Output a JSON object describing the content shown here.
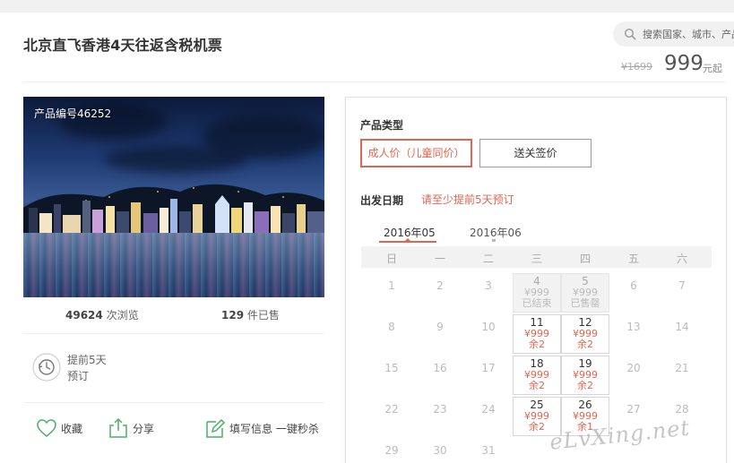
{
  "header": {
    "title": "北京直飞香港4天往返含税机票",
    "search_placeholder": "搜索国家、城市、产品",
    "old_price": "¥1699",
    "price": "999",
    "price_suffix": "元起"
  },
  "product": {
    "code_label": "产品编号46252",
    "views_count": "49624",
    "views_label": "次浏览",
    "sold_count": "129",
    "sold_label": "件已售",
    "advance_line1": "提前5天",
    "advance_line2": "预订"
  },
  "actions": {
    "favorite": "收藏",
    "share": "分享",
    "fill_info": "填写信息 一键秒杀"
  },
  "booking": {
    "type_label": "产品类型",
    "type_adult": "成人价（儿童同价）",
    "type_visa": "送关签价",
    "date_label": "出发日期",
    "date_hint": "请至少提前5天预订",
    "months": [
      "2016年05",
      "2016年06"
    ],
    "weekdays": [
      "日",
      "一",
      "二",
      "三",
      "四",
      "五",
      "六"
    ],
    "days": [
      {
        "n": "1",
        "p": "",
        "s": "",
        "state": "plain"
      },
      {
        "n": "2",
        "p": "",
        "s": "",
        "state": "plain"
      },
      {
        "n": "3",
        "p": "",
        "s": "",
        "state": "plain"
      },
      {
        "n": "4",
        "p": "¥999",
        "s": "已结束",
        "state": "closed"
      },
      {
        "n": "5",
        "p": "¥999",
        "s": "已售罄",
        "state": "closed"
      },
      {
        "n": "6",
        "p": "",
        "s": "",
        "state": "plain"
      },
      {
        "n": "7",
        "p": "",
        "s": "",
        "state": "plain"
      },
      {
        "n": "8",
        "p": "",
        "s": "",
        "state": "plain"
      },
      {
        "n": "9",
        "p": "",
        "s": "",
        "state": "plain"
      },
      {
        "n": "10",
        "p": "",
        "s": "",
        "state": "plain"
      },
      {
        "n": "11",
        "p": "¥999",
        "s": "余2",
        "state": "active"
      },
      {
        "n": "12",
        "p": "¥999",
        "s": "余2",
        "state": "active"
      },
      {
        "n": "13",
        "p": "",
        "s": "",
        "state": "plain"
      },
      {
        "n": "14",
        "p": "",
        "s": "",
        "state": "plain"
      },
      {
        "n": "15",
        "p": "",
        "s": "",
        "state": "plain"
      },
      {
        "n": "16",
        "p": "",
        "s": "",
        "state": "plain"
      },
      {
        "n": "17",
        "p": "",
        "s": "",
        "state": "plain"
      },
      {
        "n": "18",
        "p": "¥999",
        "s": "余2",
        "state": "active"
      },
      {
        "n": "19",
        "p": "¥999",
        "s": "余2",
        "state": "active"
      },
      {
        "n": "20",
        "p": "",
        "s": "",
        "state": "plain"
      },
      {
        "n": "21",
        "p": "",
        "s": "",
        "state": "plain"
      },
      {
        "n": "22",
        "p": "",
        "s": "",
        "state": "plain"
      },
      {
        "n": "23",
        "p": "",
        "s": "",
        "state": "plain"
      },
      {
        "n": "24",
        "p": "",
        "s": "",
        "state": "plain"
      },
      {
        "n": "25",
        "p": "¥999",
        "s": "余2",
        "state": "active"
      },
      {
        "n": "26",
        "p": "¥999",
        "s": "余1",
        "state": "active"
      },
      {
        "n": "27",
        "p": "",
        "s": "",
        "state": "plain"
      },
      {
        "n": "28",
        "p": "",
        "s": "",
        "state": "plain"
      },
      {
        "n": "29",
        "p": "",
        "s": "",
        "state": "plain"
      },
      {
        "n": "30",
        "p": "",
        "s": "",
        "state": "plain"
      },
      {
        "n": "31",
        "p": "",
        "s": "",
        "state": "plain"
      }
    ]
  },
  "watermark": "eLvXing.net",
  "colors": {
    "accent": "#e0664f",
    "favorite_icon": "#4cae6b",
    "action_icon": "#4cae6b"
  },
  "icons": {
    "search": "search-icon",
    "clock": "clock-icon",
    "favorite": "heart-icon",
    "share": "share-icon",
    "fill_info": "edit-icon"
  }
}
